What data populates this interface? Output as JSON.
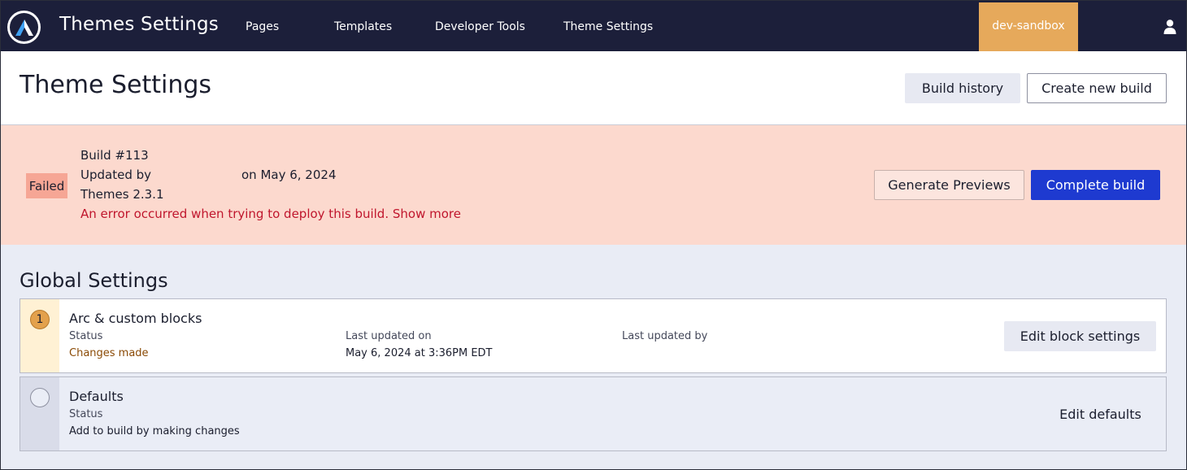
{
  "topbar": {
    "app_title": "Themes Settings",
    "nav": [
      "Pages",
      "Templates",
      "Developer Tools",
      "Theme Settings"
    ],
    "environment": "dev-sandbox",
    "logo_icon": "arc-logo-icon",
    "user_icon": "user-icon",
    "colors": {
      "bar": "#1c1f3a",
      "env_badge": "#e6a95b"
    }
  },
  "header": {
    "title": "Theme Settings",
    "build_history_label": "Build history",
    "create_new_build_label": "Create new build"
  },
  "build": {
    "status": "Failed",
    "number": "Build #113",
    "updated_by": "Updated by",
    "updated_on": "on May 6, 2024",
    "version": "Themes 2.3.1",
    "error": "An error occurred when trying to deploy this build.",
    "show_more": "Show more",
    "generate_previews_label": "Generate Previews",
    "complete_build_label": "Complete build",
    "colors": {
      "banner": "#fcd9ce",
      "error_text": "#c0162d",
      "primary": "#1e3ad0"
    }
  },
  "global_settings": {
    "title": "Global Settings",
    "items": [
      {
        "step": "1",
        "title": "Arc & custom blocks",
        "status_label": "Status",
        "status_value": "Changes made",
        "last_updated_on_label": "Last updated on",
        "last_updated_on_value": "May 6, 2024 at 3:36PM EDT",
        "last_updated_by_label": "Last updated by",
        "action_label": "Edit block settings"
      },
      {
        "title": "Defaults",
        "status_label": "Status",
        "status_value": "Add to build by making changes",
        "action_label": "Edit defaults"
      }
    ]
  }
}
